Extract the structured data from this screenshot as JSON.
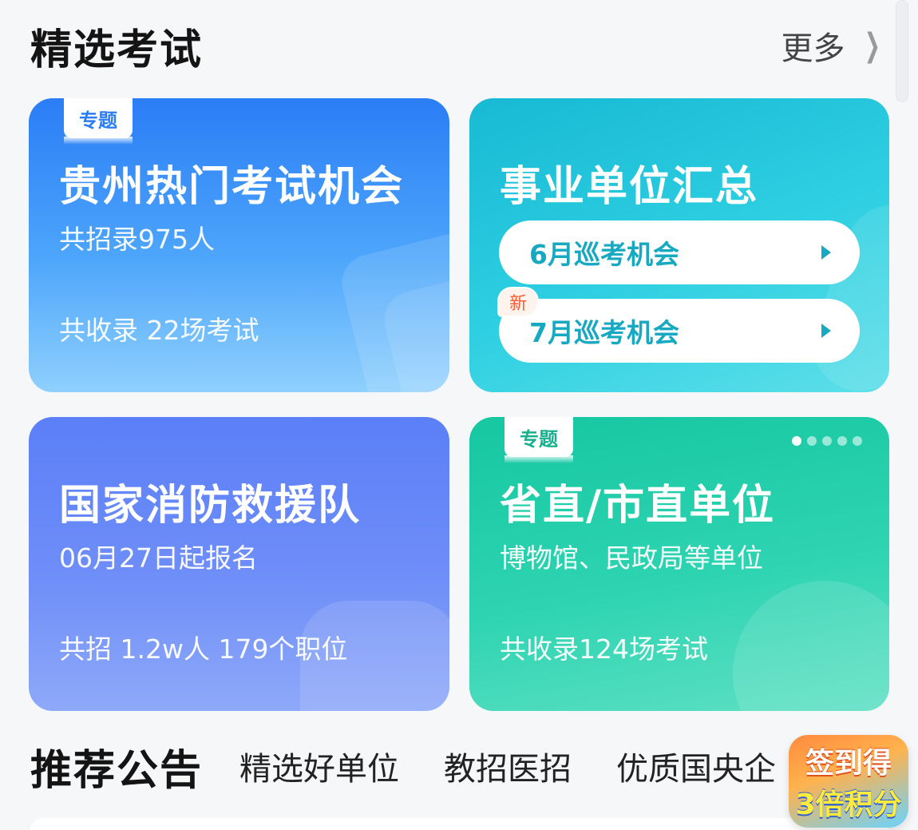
{
  "header": {
    "title": "精选考试",
    "more_label": "更多",
    "more_icon": "chevron-right-icon"
  },
  "cards": [
    {
      "tag": "专题",
      "title": "贵州热门考试机会",
      "subtitle": "共招录975人",
      "footer": "共收录 22场考试",
      "color": "#2b7df5"
    },
    {
      "title": "事业单位汇总",
      "links": [
        {
          "label": "6月巡考机会"
        },
        {
          "label": "7月巡考机会",
          "badge": "新"
        }
      ],
      "color": "#17b9d4"
    },
    {
      "title": "国家消防救援队",
      "subtitle": "06月27日起报名",
      "footer": "共招 1.2w人 179个职位",
      "color": "#5b7ff7"
    },
    {
      "tag": "专题",
      "title": "省直/市直单位",
      "subtitle": "博物馆、民政局等单位",
      "footer": "共收录124场考试",
      "carousel": {
        "total": 5,
        "active": 1
      },
      "color": "#16c7a2"
    }
  ],
  "recommend": {
    "title": "推荐公告",
    "tabs": [
      "精选好单位",
      "教招医招",
      "优质国央企"
    ]
  },
  "float_badge": {
    "line1": "签到得",
    "line2": "3倍积分"
  }
}
